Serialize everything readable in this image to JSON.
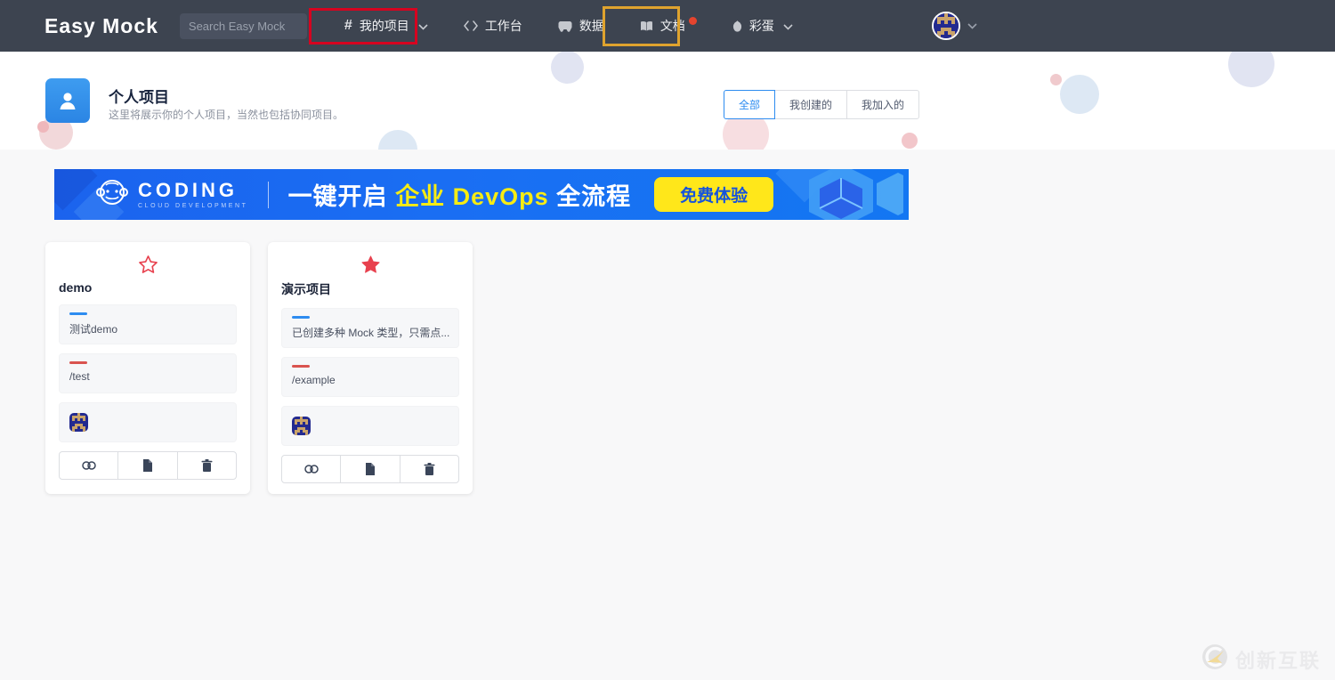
{
  "navbar": {
    "logo": "Easy Mock",
    "search_placeholder": "Search Easy Mock",
    "items": [
      {
        "label": "我的项目",
        "icon": "hash-icon",
        "has_dropdown": true,
        "annotation": "red-box"
      },
      {
        "label": "工作台",
        "icon": "code-icon"
      },
      {
        "label": "数据",
        "icon": "data-icon"
      },
      {
        "label": "文档",
        "icon": "book-icon",
        "badge_dot": true,
        "annotation": "orange-box"
      },
      {
        "label": "彩蛋",
        "icon": "egg-icon",
        "has_dropdown": true
      }
    ],
    "hash_glyph": "#"
  },
  "header": {
    "title": "个人项目",
    "subtitle": "这里将展示你的个人项目，当然也包括协同项目。",
    "tabs": [
      {
        "label": "全部",
        "active": true
      },
      {
        "label": "我创建的",
        "active": false
      },
      {
        "label": "我加入的",
        "active": false
      }
    ]
  },
  "banner": {
    "brand": "CODING",
    "brand_sub": "CLOUD DEVELOPMENT",
    "headline_white_1": "一键开启 ",
    "headline_yellow": "企业 DevOps",
    "headline_white_2": " 全流程",
    "cta_label": "免费体验"
  },
  "projects": [
    {
      "name": "demo",
      "starred": false,
      "description": "测试demo",
      "url": "/test"
    },
    {
      "name": "演示项目",
      "starred": true,
      "description": "已创建多种 Mock 类型，只需点...",
      "url": "/example"
    }
  ],
  "watermark": {
    "text": "创新互联"
  },
  "colors": {
    "navbar_bg": "#3d4450",
    "accent_blue": "#2d8cf0",
    "star_red": "#e8414e",
    "desc_bar": "#2d8cf0",
    "url_bar": "#d9534f",
    "annotation_red": "#d60420",
    "annotation_orange": "#dfa32e",
    "banner_blue": "#1a6ef3",
    "banner_yellow": "#f7ec13",
    "cta_yellow": "#ffe71a",
    "badge_dot": "#e5442e"
  }
}
